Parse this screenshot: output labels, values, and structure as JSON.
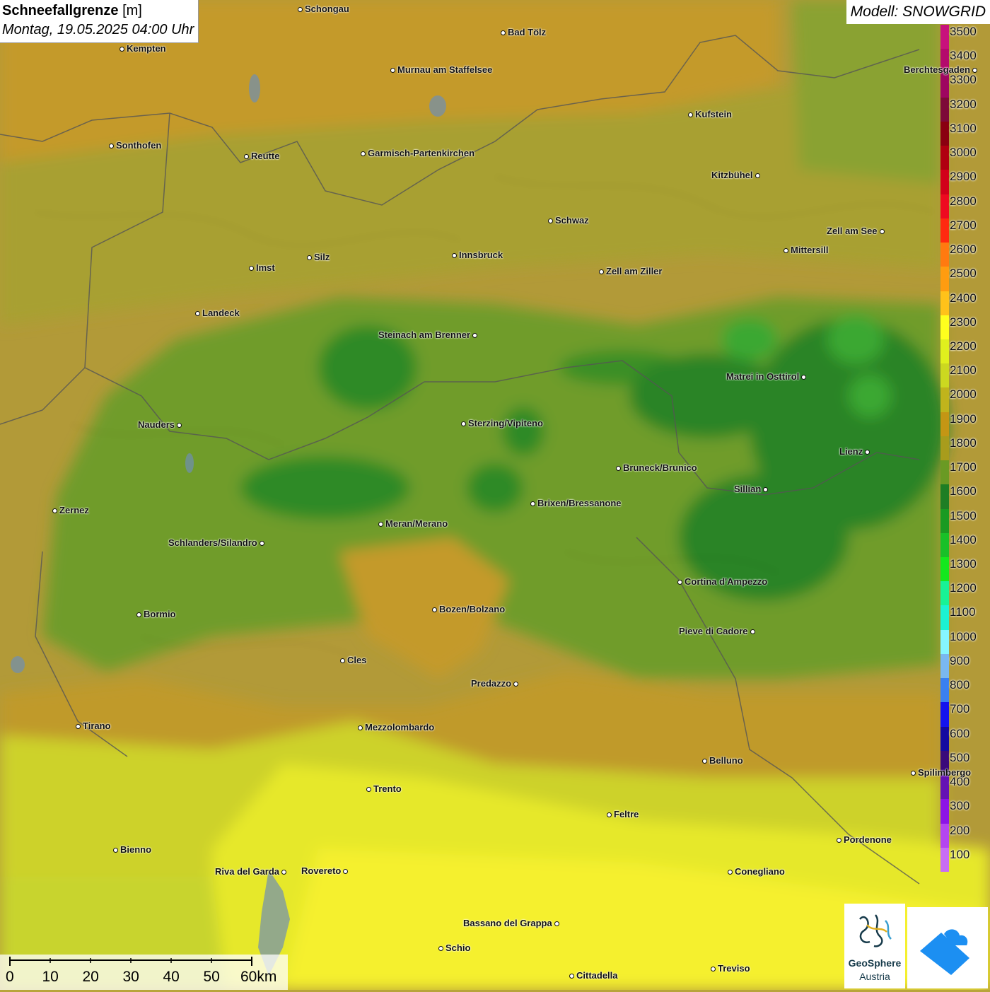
{
  "header": {
    "title_bold": "Schneefallgrenze",
    "title_unit": "[m]",
    "datetime": "Montag, 19.05.2025 04:00 Uhr",
    "model": "Modell: SNOWGRID"
  },
  "legend": {
    "levels": [
      {
        "label": "3500",
        "color": "#c8127c"
      },
      {
        "label": "3400",
        "color": "#b40a6c"
      },
      {
        "label": "3300",
        "color": "#9e0660"
      },
      {
        "label": "3200",
        "color": "#7d0a38"
      },
      {
        "label": "3100",
        "color": "#8a0010"
      },
      {
        "label": "3000",
        "color": "#b00010"
      },
      {
        "label": "2900",
        "color": "#d2001a"
      },
      {
        "label": "2800",
        "color": "#ee0a20"
      },
      {
        "label": "2700",
        "color": "#ff2a10"
      },
      {
        "label": "2600",
        "color": "#ff7a10"
      },
      {
        "label": "2500",
        "color": "#ff9c10"
      },
      {
        "label": "2400",
        "color": "#ffc21a"
      },
      {
        "label": "2300",
        "color": "#ffff1e"
      },
      {
        "label": "2200",
        "color": "#e0f01e"
      },
      {
        "label": "2100",
        "color": "#ccd820"
      },
      {
        "label": "2000",
        "color": "#c0b41c"
      },
      {
        "label": "1900",
        "color": "#c49614"
      },
      {
        "label": "1800",
        "color": "#a89c1c"
      },
      {
        "label": "1700",
        "color": "#6a9a24"
      },
      {
        "label": "1600",
        "color": "#1e7e24"
      },
      {
        "label": "1500",
        "color": "#1a9a22"
      },
      {
        "label": "1400",
        "color": "#18c028"
      },
      {
        "label": "1300",
        "color": "#14e81e"
      },
      {
        "label": "1200",
        "color": "#18f296"
      },
      {
        "label": "1100",
        "color": "#1cf2d2"
      },
      {
        "label": "1000",
        "color": "#86f6ff"
      },
      {
        "label": "900",
        "color": "#7ab8f0"
      },
      {
        "label": "800",
        "color": "#3a80f0"
      },
      {
        "label": "700",
        "color": "#1414ee"
      },
      {
        "label": "600",
        "color": "#140aa0"
      },
      {
        "label": "500",
        "color": "#3a0a7a"
      },
      {
        "label": "400",
        "color": "#6412b4"
      },
      {
        "label": "300",
        "color": "#8c14e6"
      },
      {
        "label": "200",
        "color": "#b446f0"
      },
      {
        "label": "100",
        "color": "#c86ef4"
      }
    ]
  },
  "cities": [
    {
      "name": "Schongau",
      "label_side": "right"
    },
    {
      "name": "Kempten",
      "label_side": "right"
    },
    {
      "name": "Bad Tölz",
      "label_side": "right"
    },
    {
      "name": "Murnau am Staffelsee",
      "label_side": "right"
    },
    {
      "name": "Berchtesgaden",
      "label_side": "left"
    },
    {
      "name": "Kufstein",
      "label_side": "right"
    },
    {
      "name": "Sonthofen",
      "label_side": "right"
    },
    {
      "name": "Reutte",
      "label_side": "right"
    },
    {
      "name": "Garmisch-Partenkirchen",
      "label_side": "right"
    },
    {
      "name": "Kitzbühel",
      "label_side": "left"
    },
    {
      "name": "Schwaz",
      "label_side": "right"
    },
    {
      "name": "Zell am See",
      "label_side": "left"
    },
    {
      "name": "Mittersill",
      "label_side": "right"
    },
    {
      "name": "Innsbruck",
      "label_side": "right"
    },
    {
      "name": "Imst",
      "label_side": "right"
    },
    {
      "name": "Silz",
      "label_side": "right"
    },
    {
      "name": "Zell am Ziller",
      "label_side": "right"
    },
    {
      "name": "Landeck",
      "label_side": "right"
    },
    {
      "name": "Steinach am Brenner",
      "label_side": "left"
    },
    {
      "name": "Matrei in Osttirol",
      "label_side": "left"
    },
    {
      "name": "Nauders",
      "label_side": "left"
    },
    {
      "name": "Sterzing/Vipiteno",
      "label_side": "right"
    },
    {
      "name": "Lienz",
      "label_side": "left"
    },
    {
      "name": "Bruneck/Brunico",
      "label_side": "right"
    },
    {
      "name": "Sillian",
      "label_side": "left"
    },
    {
      "name": "Zernez",
      "label_side": "right"
    },
    {
      "name": "Brixen/Bressanone",
      "label_side": "right"
    },
    {
      "name": "Meran/Merano",
      "label_side": "right"
    },
    {
      "name": "Schlanders/Silandro",
      "label_side": "left"
    },
    {
      "name": "Cortina d'Ampezzo",
      "label_side": "right"
    },
    {
      "name": "Bozen/Bolzano",
      "label_side": "right"
    },
    {
      "name": "Bormio",
      "label_side": "right"
    },
    {
      "name": "Pieve di Cadore",
      "label_side": "left"
    },
    {
      "name": "Cles",
      "label_side": "right"
    },
    {
      "name": "Predazzo",
      "label_side": "left"
    },
    {
      "name": "Tirano",
      "label_side": "right"
    },
    {
      "name": "Mezzolombardo",
      "label_side": "right"
    },
    {
      "name": "Belluno",
      "label_side": "right"
    },
    {
      "name": "Spilimbergo",
      "label_side": "right"
    },
    {
      "name": "Trento",
      "label_side": "right"
    },
    {
      "name": "Feltre",
      "label_side": "right"
    },
    {
      "name": "Pordenone",
      "label_side": "right"
    },
    {
      "name": "Bienno",
      "label_side": "right"
    },
    {
      "name": "Riva del Garda",
      "label_side": "left"
    },
    {
      "name": "Rovereto",
      "label_side": "left"
    },
    {
      "name": "Conegliano",
      "label_side": "right"
    },
    {
      "name": "Bassano del Grappa",
      "label_side": "left"
    },
    {
      "name": "Schio",
      "label_side": "right"
    },
    {
      "name": "Treviso",
      "label_side": "right"
    },
    {
      "name": "Cittadella",
      "label_side": "right"
    }
  ],
  "scalebar": {
    "labels": [
      "0",
      "10",
      "20",
      "30",
      "40",
      "50",
      "60km"
    ]
  },
  "logos": {
    "geosphere_line1": "GeoSphere",
    "geosphere_line2": "Austria"
  }
}
